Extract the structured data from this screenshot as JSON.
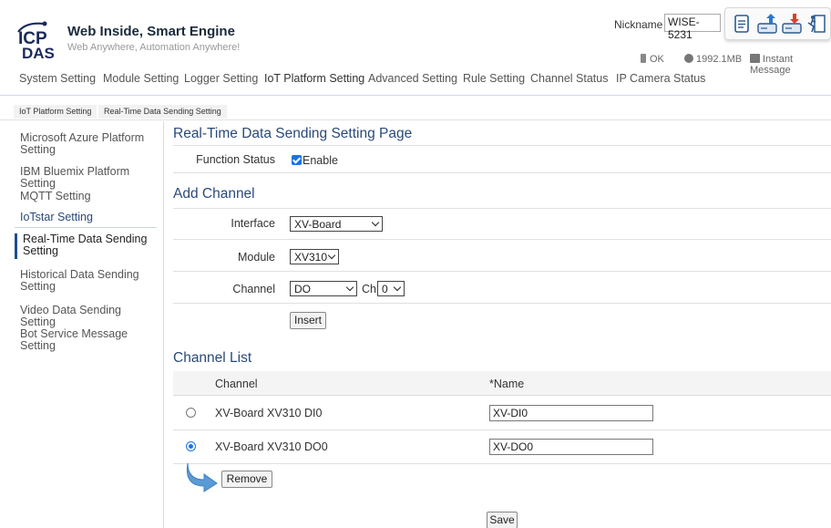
{
  "header": {
    "brand_title": "Web Inside, Smart Engine",
    "brand_subtitle": "Web Anywhere, Automation Anywhere!",
    "logo_top": "ICP",
    "logo_bottom": "DAS",
    "nickname_label": "Nickname",
    "nickname_value": "WISE-5231",
    "status_ok": "OK",
    "status_memory": "1992.1MB",
    "status_message": "Instant Message",
    "tool_icons": [
      "document-icon",
      "upload-icon",
      "download-icon",
      "logout-icon"
    ]
  },
  "topnav": {
    "items": [
      "System Setting",
      "Module Setting",
      "Logger Setting",
      "IoT Platform Setting",
      "Advanced Setting",
      "Rule Setting",
      "Channel Status",
      "IP Camera Status"
    ],
    "active": "IoT Platform Setting"
  },
  "breadcrumb": [
    "IoT Platform Setting",
    "Real-Time Data Sending Setting"
  ],
  "sidebar": {
    "items": [
      "Microsoft Azure Platform Setting",
      "IBM Bluemix Platform Setting",
      "MQTT Setting",
      "IoTstar Setting",
      "Real-Time Data Sending Setting",
      "Historical Data Sending Setting",
      "Video Data Sending Setting",
      "Bot Service Message Setting"
    ],
    "active": "Real-Time Data Sending Setting"
  },
  "main": {
    "page_title": "Real-Time Data Sending Setting Page",
    "function_status_label": "Function Status",
    "function_status_value": "Enable",
    "function_status_checked": true,
    "add_channel_title": "Add Channel",
    "interface_label": "Interface",
    "interface_value": "XV-Board",
    "module_label": "Module",
    "module_value": "XV310",
    "channel_label": "Channel",
    "channel_value": "DO",
    "ch_label": "Ch.",
    "ch_value": "0",
    "insert_button": "Insert",
    "channel_list_title": "Channel List",
    "list_columns": [
      "Channel",
      "*Name"
    ],
    "rows": [
      {
        "channel": "XV-Board XV310 DI0",
        "name": "XV-DI0",
        "selected": false
      },
      {
        "channel": "XV-Board XV310 DO0",
        "name": "XV-DO0",
        "selected": true
      }
    ],
    "remove_button": "Remove",
    "save_button": "Save"
  },
  "colors": {
    "accent": "#1a73e8",
    "title_blue": "#2a4a7a",
    "sidebar_active_bar": "#1f4e8c"
  }
}
